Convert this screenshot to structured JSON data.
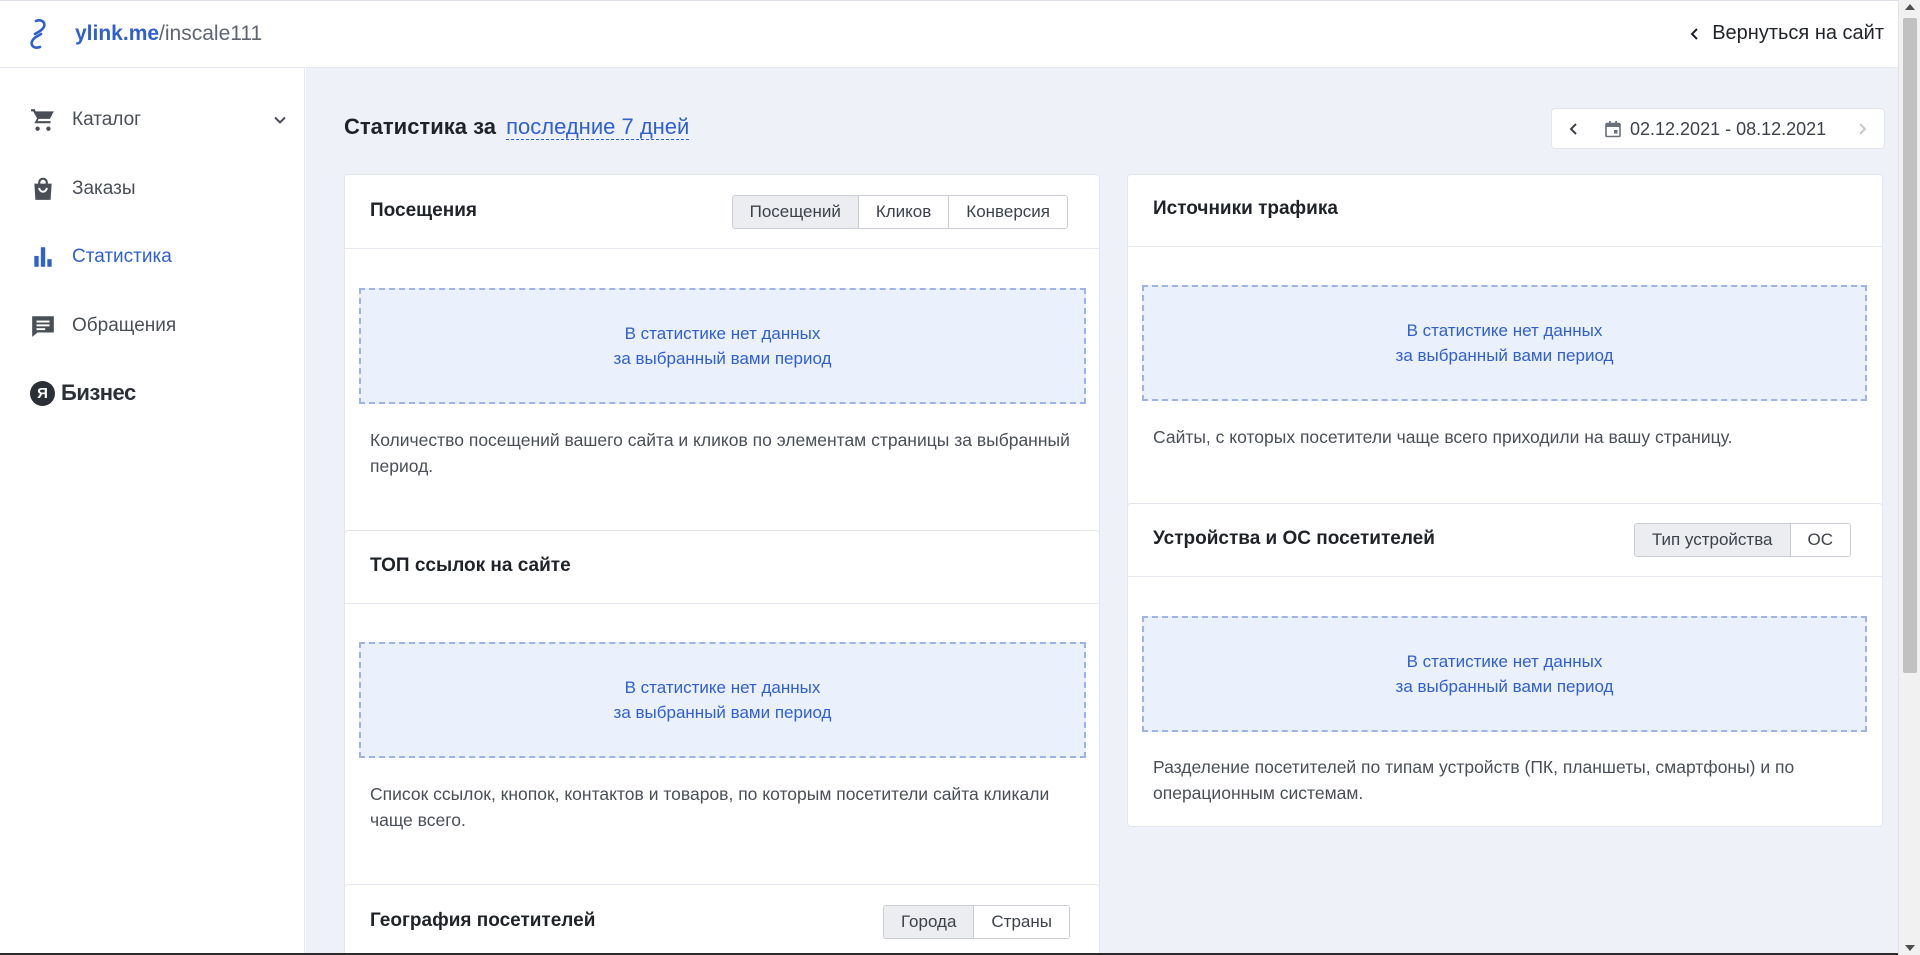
{
  "header": {
    "domain": "ylink.me",
    "slash": "/",
    "username": "inscale111",
    "back_label": "Вернуться на сайт"
  },
  "sidebar": {
    "items": [
      {
        "label": "Каталог",
        "icon": "cart-icon",
        "has_dropdown": true,
        "active": false
      },
      {
        "label": "Заказы",
        "icon": "shopping-bag-icon",
        "active": false
      },
      {
        "label": "Статистика",
        "icon": "bar-chart-icon",
        "active": true
      },
      {
        "label": "Обращения",
        "icon": "chat-icon",
        "active": false
      }
    ],
    "biz_logo": {
      "mark": "Я",
      "text": "Бизнес"
    }
  },
  "main": {
    "title_prefix": "Статистика за",
    "period": "последние 7 дней",
    "date_range": "02.12.2021 - 08.12.2021"
  },
  "empty_state": {
    "line1": "В статистике нет данных",
    "line2": "за выбранный вами период"
  },
  "cards": {
    "visits": {
      "title": "Посещения",
      "tabs": [
        "Посещений",
        "Кликов",
        "Конверсия"
      ],
      "selected_tab": "Посещений",
      "description": "Количество посещений вашего сайта и кликов по элементам страницы за выбранный период."
    },
    "traffic": {
      "title": "Источники трафика",
      "description": "Сайты, с которых посетители чаще всего приходили на вашу страницу."
    },
    "top_links": {
      "title": "ТОП ссылок на сайте",
      "description": "Список ссылок, кнопок, контактов и товаров, по которым посетители сайта кликали чаще всего."
    },
    "devices": {
      "title": "Устройства и ОС посетителей",
      "tabs": [
        "Тип устройства",
        "ОС"
      ],
      "selected_tab": "Тип устройства",
      "description": "Разделение посетителей по типам устройств (ПК, планшеты, смартфоны) и по операционным системам."
    },
    "geo": {
      "title": "География посетителей",
      "tabs": [
        "Города",
        "Страны"
      ],
      "selected_tab": "Города"
    }
  },
  "colors": {
    "accent": "#2f5fd0",
    "page_bg": "#eef1f8",
    "empty_bg": "#eaf0fc",
    "empty_border": "#9fb4e6"
  }
}
